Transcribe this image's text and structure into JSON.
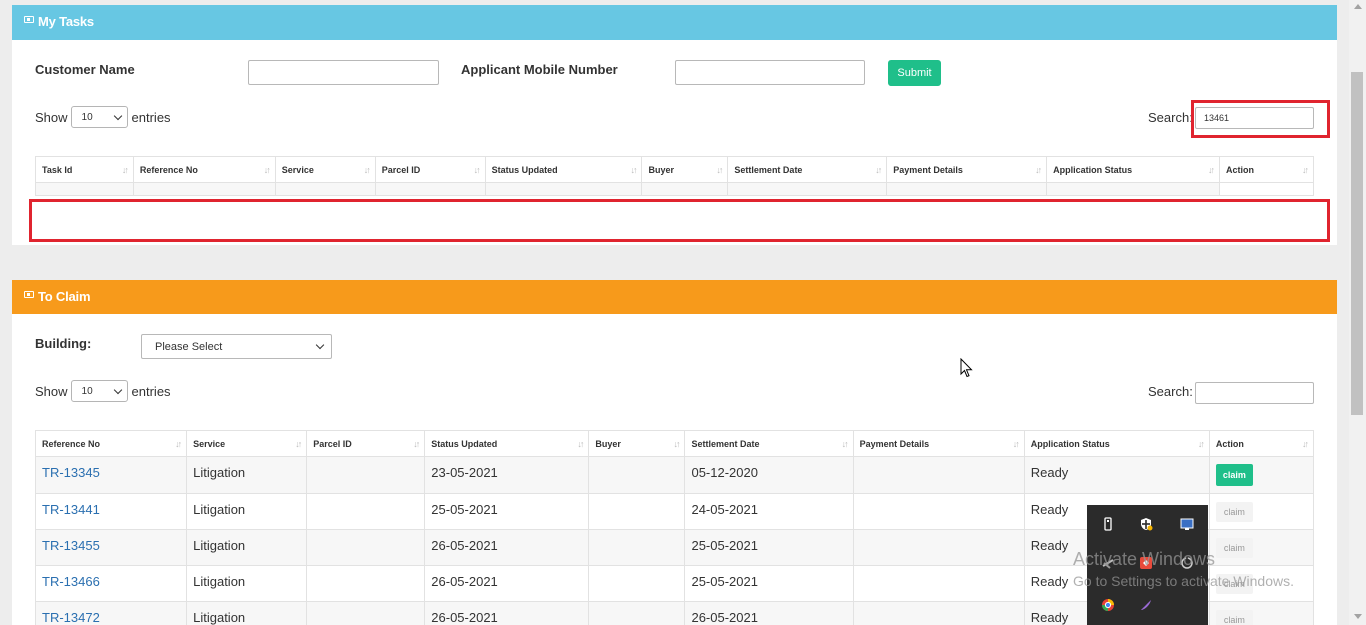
{
  "my_tasks": {
    "title": "My Tasks",
    "customer_name_label": "Customer Name",
    "mobile_label": "Applicant Mobile Number",
    "customer_name_value": "",
    "mobile_value": "",
    "submit_label": "Submit",
    "show_label": "Show",
    "entries_value": "10",
    "entries_label": "entries",
    "search_label": "Search:",
    "search_value": "13461",
    "columns": [
      "Task Id",
      "Reference No",
      "Service",
      "Parcel ID",
      "Status Updated",
      "Buyer",
      "Settlement Date",
      "Payment Details",
      "Application Status",
      "Action"
    ]
  },
  "to_claim": {
    "title": "To Claim",
    "building_label": "Building:",
    "building_value": "Please Select",
    "show_label": "Show",
    "entries_value": "10",
    "entries_label": "entries",
    "search_label": "Search:",
    "search_value": "",
    "columns": [
      "Reference No",
      "Service",
      "Parcel ID",
      "Status Updated",
      "Buyer",
      "Settlement Date",
      "Payment Details",
      "Application Status",
      "Action"
    ],
    "rows": [
      {
        "ref": "TR-13345",
        "service": "Litigation",
        "parcel": "",
        "status_updated": "23-05-2021",
        "buyer": "",
        "settlement": "05-12-2020",
        "payment": "",
        "app_status": "Ready",
        "action": "claim",
        "enabled": true
      },
      {
        "ref": "TR-13441",
        "service": "Litigation",
        "parcel": "",
        "status_updated": "25-05-2021",
        "buyer": "",
        "settlement": "24-05-2021",
        "payment": "",
        "app_status": "Ready",
        "action": "claim",
        "enabled": false
      },
      {
        "ref": "TR-13455",
        "service": "Litigation",
        "parcel": "",
        "status_updated": "26-05-2021",
        "buyer": "",
        "settlement": "25-05-2021",
        "payment": "",
        "app_status": "Ready",
        "action": "claim",
        "enabled": false
      },
      {
        "ref": "TR-13466",
        "service": "Litigation",
        "parcel": "",
        "status_updated": "26-05-2021",
        "buyer": "",
        "settlement": "25-05-2021",
        "payment": "",
        "app_status": "Ready",
        "action": "claim",
        "enabled": false
      },
      {
        "ref": "TR-13472",
        "service": "Litigation",
        "parcel": "",
        "status_updated": "26-05-2021",
        "buyer": "",
        "settlement": "26-05-2021",
        "payment": "",
        "app_status": "Ready",
        "action": "claim",
        "enabled": false
      }
    ]
  },
  "watermark": {
    "line1": "Activate Windows",
    "line2": "Go to Settings to activate Windows."
  },
  "tray_icons": [
    "usb-drive-icon",
    "security-shield-icon",
    "display-icon",
    "network-icon",
    "red-app-icon",
    "power-icon",
    "browser-icon",
    "feather-icon"
  ],
  "colors": {
    "my_tasks_header": "#67c7e3",
    "to_claim_header": "#f79a1b",
    "submit_button": "#1fbf8a",
    "highlight_box": "#e0242f"
  }
}
